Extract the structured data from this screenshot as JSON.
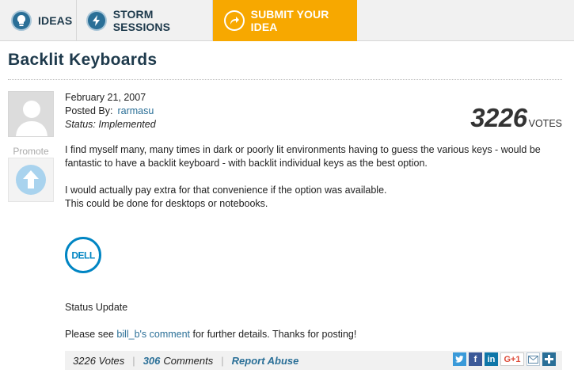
{
  "nav": {
    "ideas": "IDEAS",
    "storm": "STORM SESSIONS",
    "submit": "SUBMIT YOUR IDEA"
  },
  "idea": {
    "title": "Backlit Keyboards",
    "date": "February 21, 2007",
    "posted_by_label": "Posted By:",
    "author": "rarmasu",
    "status": "Status: Implemented",
    "votes": "3226",
    "votes_label": "VOTES",
    "promote_label": "Promote",
    "paragraph1": "I find myself many, many times in dark or poorly lit environments having to guess the various keys - would be fantastic to have a backlit keyboard - with backlit individual keys as the best option.",
    "paragraph2": "I would actually pay extra for that convenience if the option was available.",
    "paragraph3": "This could be done for desktops or notebooks.",
    "logo_text": "DELL",
    "status_update": "Status Update",
    "see_prefix": "Please see ",
    "see_link": "bill_b's comment",
    "see_suffix": " for further details.  Thanks for posting!"
  },
  "footer": {
    "votes": "3226 Votes",
    "comments_count": "306",
    "comments_label": "Comments",
    "report": "Report Abuse",
    "gplus": "G+1"
  },
  "colors": {
    "brand_blue": "#2a6f97",
    "submit_orange": "#f7a800",
    "title_navy": "#1e3a4c"
  }
}
